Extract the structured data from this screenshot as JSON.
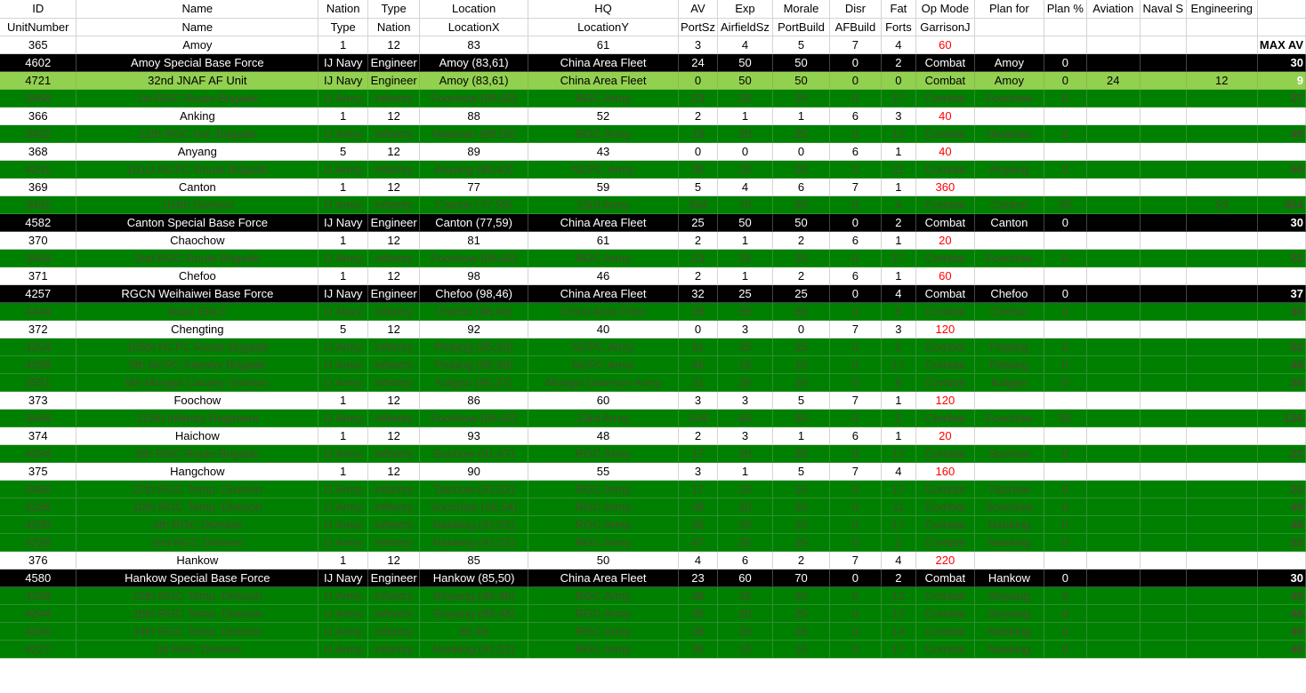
{
  "header1": [
    "ID",
    "Name",
    "Nation",
    "Type",
    "Location",
    "HQ",
    "AV",
    "Exp",
    "Morale",
    "Disr",
    "Fat",
    "Op Mode",
    "Plan for",
    "Plan %",
    "Aviation",
    "Naval S",
    "Engineering",
    ""
  ],
  "header2": [
    "UnitNumber",
    "Name",
    "Type",
    "Nation",
    "LocationX",
    "LocationY",
    "PortSz",
    "AirfieldSz",
    "PortBuild",
    "AFBuild",
    "Forts",
    "GarrisonJ",
    "",
    "",
    "",
    "",
    "",
    ""
  ],
  "rows": [
    {
      "style": "white",
      "cells": [
        "365",
        "Amoy",
        "1",
        "12",
        "83",
        "61",
        "3",
        "4",
        "5",
        "7",
        "4",
        "60",
        "",
        "",
        "",
        "",
        "",
        "MAX AV"
      ]
    },
    {
      "style": "black",
      "cells": [
        "4602",
        "Amoy Special Base Force",
        "IJ Navy",
        "Engineer",
        "Amoy (83,61)",
        "China Area Fleet",
        "24",
        "50",
        "50",
        "0",
        "2",
        "Combat",
        "Amoy",
        "0",
        "",
        "",
        "",
        "30"
      ]
    },
    {
      "style": "light",
      "cells": [
        "4721",
        "32nd JNAF AF Unit",
        "IJ Navy",
        "Engineer",
        "Amoy (83,61)",
        "China Area Fleet",
        "0",
        "50",
        "50",
        "0",
        "0",
        "Combat",
        "Amoy",
        "0",
        "24",
        "",
        "12",
        "9"
      ]
    },
    {
      "style": "dark",
      "cells": [
        "3468",
        "1st RGC Route Brigade",
        "IJ Army",
        "Infantry",
        "Foochow (86,60)",
        "RGC Army",
        "23",
        "25",
        "25",
        "0",
        "17",
        "Combat",
        "Foochow",
        "0",
        "",
        "",
        "",
        "27"
      ]
    },
    {
      "style": "white",
      "cells": [
        "366",
        "Anking",
        "1",
        "12",
        "88",
        "52",
        "2",
        "1",
        "1",
        "6",
        "3",
        "40",
        "",
        "",
        "",
        "",
        "",
        ""
      ]
    },
    {
      "style": "dark",
      "cells": [
        "3422",
        "12th RGC Ind. Brigade",
        "IJ Army",
        "Infantry",
        "Hwainan (89,50)",
        "RGC Army",
        "19",
        "20",
        "25",
        "0",
        "12",
        "Combat",
        "Hwainan",
        "0",
        "",
        "",
        "",
        "48"
      ]
    },
    {
      "style": "white",
      "cells": [
        "368",
        "Anyang",
        "5",
        "12",
        "89",
        "43",
        "0",
        "0",
        "0",
        "6",
        "1",
        "40",
        "",
        "",
        "",
        "",
        "",
        ""
      ]
    },
    {
      "style": "dark",
      "cells": [
        "4241",
        "101st NCPC Route Brigade",
        "IJ Army",
        "Infantry",
        "Anyang (89,43)",
        "NCPC Army",
        "35",
        "25",
        "25",
        "0",
        "11",
        "Combat",
        "Anyang",
        "0",
        "",
        "",
        "",
        "50"
      ]
    },
    {
      "style": "white",
      "cells": [
        "369",
        "Canton",
        "1",
        "12",
        "77",
        "59",
        "5",
        "4",
        "6",
        "7",
        "1",
        "360",
        "",
        "",
        "",
        "",
        "",
        ""
      ]
    },
    {
      "style": "dark",
      "cells": [
        "3432",
        "104th Division",
        "IJ Army",
        "Infantry",
        "Canton (77,59)",
        "23rd Army",
        "394",
        "70",
        "65",
        "0",
        "4",
        "Combat",
        "Canton",
        "50",
        "",
        "",
        "53",
        "454"
      ]
    },
    {
      "style": "black",
      "cells": [
        "4582",
        "Canton Special Base Force",
        "IJ Navy",
        "Engineer",
        "Canton (77,59)",
        "China Area Fleet",
        "25",
        "50",
        "50",
        "0",
        "2",
        "Combat",
        "Canton",
        "0",
        "",
        "",
        "",
        "30"
      ]
    },
    {
      "style": "white",
      "cells": [
        "370",
        "Chaochow",
        "1",
        "12",
        "81",
        "61",
        "2",
        "1",
        "2",
        "6",
        "1",
        "20",
        "",
        "",
        "",
        "",
        "",
        ""
      ]
    },
    {
      "style": "dark",
      "cells": [
        "3469",
        "2nd RGC Route Brigade",
        "IJ Army",
        "Infantry",
        "Foochow (86,60)",
        "RGC Army",
        "23",
        "25",
        "25",
        "0",
        "17",
        "Combat",
        "Foochow",
        "0",
        "",
        "",
        "",
        "23"
      ]
    },
    {
      "style": "white",
      "cells": [
        "371",
        "Chefoo",
        "1",
        "12",
        "98",
        "46",
        "2",
        "1",
        "2",
        "6",
        "1",
        "60",
        "",
        "",
        "",
        "",
        "",
        ""
      ]
    },
    {
      "style": "black",
      "cells": [
        "4257",
        "RGCN Weihaiwei Base Force",
        "IJ Navy",
        "Engineer",
        "Chefoo (98,46)",
        "China Area Fleet",
        "32",
        "25",
        "25",
        "0",
        "4",
        "Combat",
        "Chefoo",
        "0",
        "",
        "",
        "",
        "37"
      ]
    },
    {
      "style": "dark",
      "cells": [
        "4444",
        "Ikaiei SNLF",
        "IJ Navy",
        "Infantry",
        "Chefoo (98,46)",
        "China Area Fleet",
        "28",
        "55",
        "60",
        "0",
        "5",
        "Combat",
        "Chefoo",
        "0",
        "",
        "",
        "",
        "30"
      ]
    },
    {
      "style": "white",
      "cells": [
        "372",
        "Chengting",
        "5",
        "12",
        "92",
        "40",
        "0",
        "3",
        "0",
        "7",
        "3",
        "120",
        "",
        "",
        "",
        "",
        "",
        ""
      ]
    },
    {
      "style": "dark",
      "cells": [
        "4254",
        "105th NCPC Route Brigade",
        "IJ Army",
        "Infantry",
        "Peiping (95,39)",
        "NCPC Army",
        "51",
        "25",
        "25",
        "0",
        "2",
        "Combat",
        "Peiping",
        "0",
        "",
        "",
        "",
        "52"
      ]
    },
    {
      "style": "dark",
      "cells": [
        "4258",
        "5th NCPC Infantry Brigade",
        "IJ Army",
        "Infantry",
        "Peiping (95,39)",
        "NCPC Army",
        "40",
        "15",
        "15",
        "0",
        "17",
        "Combat",
        "Peiping",
        "0",
        "",
        "",
        "",
        "49"
      ]
    },
    {
      "style": "dark",
      "cells": [
        "3551",
        "6th Mongol Cavalry Division",
        "IJ Army",
        "Infantry",
        "Kalgan (95,37)",
        "Mongol Garrison Army",
        "21",
        "20",
        "25",
        "0",
        "6",
        "Combat",
        "Kalgan",
        "0",
        "",
        "",
        "",
        "26"
      ]
    },
    {
      "style": "white",
      "cells": [
        "373",
        "Foochow",
        "1",
        "12",
        "86",
        "60",
        "3",
        "3",
        "5",
        "7",
        "1",
        "120",
        "",
        "",
        "",
        "",
        "",
        ""
      ]
    },
    {
      "style": "dark",
      "cells": [
        "3449",
        "115th Infantry Regiment",
        "IJ Army",
        "Infantry",
        "Foochow (86,60)",
        "23rd Army",
        "104",
        "60",
        "60",
        "0",
        "2",
        "Combat",
        "Foochow",
        "50",
        "",
        "",
        "",
        "126"
      ]
    },
    {
      "style": "white",
      "cells": [
        "374",
        "Haichow",
        "1",
        "12",
        "93",
        "48",
        "2",
        "3",
        "1",
        "6",
        "1",
        "20",
        "",
        "",
        "",
        "",
        "",
        ""
      ]
    },
    {
      "style": "dark",
      "cells": [
        "4234",
        "8th RGC Route Brigade",
        "IJ Army",
        "Infantry",
        "Suchow (91,47)",
        "RGC Army",
        "17",
        "20",
        "25",
        "0",
        "17",
        "Combat",
        "Suchow",
        "0",
        "",
        "",
        "",
        "23"
      ]
    },
    {
      "style": "white",
      "cells": [
        "375",
        "Hangchow",
        "1",
        "12",
        "90",
        "55",
        "3",
        "1",
        "5",
        "7",
        "4",
        "160",
        "",
        "",
        "",
        "",
        "",
        ""
      ]
    },
    {
      "style": "dark",
      "cells": [
        "3480",
        "27th RGC Temp. Division",
        "IJ Army",
        "Infantry",
        "Taichow (92,52)",
        "RGC Army",
        "17",
        "15",
        "15",
        "0",
        "17",
        "Combat",
        "Taichow",
        "0",
        "",
        "",
        "",
        "23"
      ]
    },
    {
      "style": "dark",
      "cells": [
        "4236",
        "10th RGC Temp. Division",
        "IJ Army",
        "Infantry",
        "Soochow (92,54)",
        "RGC Army",
        "38",
        "20",
        "20",
        "0",
        "11",
        "Combat",
        "Soochow",
        "0",
        "",
        "",
        "",
        "49"
      ]
    },
    {
      "style": "dark",
      "cells": [
        "4230",
        "4th RGC Division",
        "IJ Army",
        "Infantry",
        "Nanking (91,52)",
        "RGC Army",
        "35",
        "25",
        "25",
        "0",
        "17",
        "Combat",
        "Nanking",
        "0",
        "",
        "",
        "",
        "48"
      ]
    },
    {
      "style": "dark",
      "cells": [
        "4228",
        "2nd RGC Division",
        "IJ Army",
        "Infantry",
        "Nanking (91,52)",
        "RGC Army",
        "47",
        "25",
        "25",
        "0",
        "2",
        "Combat",
        "Nanking",
        "0",
        "",
        "",
        "",
        "52"
      ]
    },
    {
      "style": "white",
      "cells": [
        "376",
        "Hankow",
        "1",
        "12",
        "85",
        "50",
        "4",
        "6",
        "2",
        "7",
        "4",
        "220",
        "",
        "",
        "",
        "",
        "",
        ""
      ]
    },
    {
      "style": "black",
      "cells": [
        "4580",
        "Hankow Special Base Force",
        "IJ Navy",
        "Engineer",
        "Hankow (85,50)",
        "China Area Fleet",
        "23",
        "60",
        "70",
        "0",
        "2",
        "Combat",
        "Hankow",
        "0",
        "",
        "",
        "",
        "30"
      ]
    },
    {
      "style": "dark",
      "cells": [
        "4238",
        "12th RGC Temp. Division",
        "IJ Army",
        "Infantry",
        "Sinyang (86,48)",
        "RGC Army",
        "38",
        "25",
        "25",
        "0",
        "12",
        "Combat",
        "Sinyang",
        "0",
        "",
        "",
        "",
        "49"
      ]
    },
    {
      "style": "dark",
      "cells": [
        "4244",
        "18th RGC Temp. Division",
        "IJ Army",
        "Infantry",
        "Sinyang (86,48)",
        "RGC Army",
        "35",
        "20",
        "25",
        "0",
        "17",
        "Combat",
        "Sinyang",
        "0",
        "",
        "",
        "",
        "48"
      ]
    },
    {
      "style": "dark",
      "cells": [
        "4240",
        "14th RGC Temp. Division",
        "IJ Army",
        "Infantry",
        "85,49",
        "RGC Army",
        "38",
        "20",
        "25",
        "0",
        "14",
        "Combat",
        "Nanking",
        "0",
        "",
        "",
        "",
        "49"
      ]
    },
    {
      "style": "dark",
      "cells": [
        "4227",
        "1st RGC Division",
        "IJ Army",
        "Infantry",
        "Nanking (91,52)",
        "RGC Army",
        "35",
        "15",
        "15",
        "0",
        "17",
        "Combat",
        "Nanking",
        "0",
        "",
        "",
        "",
        "48"
      ]
    }
  ]
}
